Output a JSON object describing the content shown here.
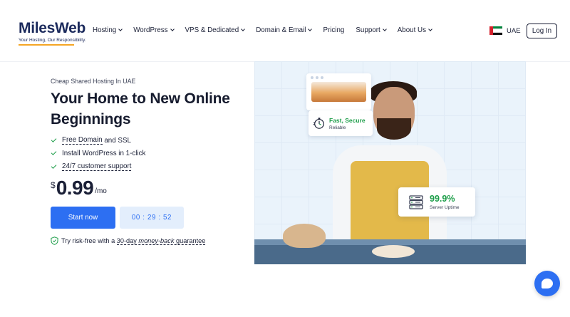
{
  "header": {
    "logo": {
      "word": "MilesWeb",
      "tagline": "Your Hosting, Our Responsibility."
    },
    "nav": [
      {
        "label": "Hosting",
        "dropdown": true
      },
      {
        "label": "WordPress",
        "dropdown": true
      },
      {
        "label": "VPS & Dedicated",
        "dropdown": true
      },
      {
        "label": "Domain & Email",
        "dropdown": true
      },
      {
        "label": "Pricing",
        "dropdown": false
      },
      {
        "label": "Support",
        "dropdown": true
      },
      {
        "label": "About Us",
        "dropdown": true
      }
    ],
    "region": {
      "label": "UAE",
      "flag": "uae-flag-icon"
    },
    "login_label": "Log In"
  },
  "hero": {
    "eyebrow": "Cheap Shared Hosting In UAE",
    "title": "Your Home to New Online Beginnings",
    "features": [
      {
        "text": "Free Domain",
        "underline": true,
        "suffix": " and SSL"
      },
      {
        "text": "Install WordPress in 1-click",
        "underline": false,
        "suffix": ""
      },
      {
        "text": "24/7 customer support",
        "underline": true,
        "suffix": ""
      }
    ],
    "price": {
      "currency": "$",
      "amount": "0.99",
      "period": "/mo"
    },
    "cta_label": "Start now",
    "timer": "00 : 29 : 52",
    "guarantee": {
      "prefix": "Try risk-free with a ",
      "emphasis_start": "30-day ",
      "emphasis": "money-back",
      "suffix": " guarantee"
    }
  },
  "badges": {
    "fast": {
      "title": "Fast, Secure",
      "subtitle": "Reliable",
      "icon": "stopwatch-icon"
    },
    "uptime": {
      "value": "99.9%",
      "subtitle": "Server Uptime",
      "icon": "server-icon"
    }
  },
  "colors": {
    "accent": "#2d6ff2",
    "success": "#1e9e4a",
    "brand": "#1b2a5c",
    "logo_underline": "#f5a524"
  }
}
